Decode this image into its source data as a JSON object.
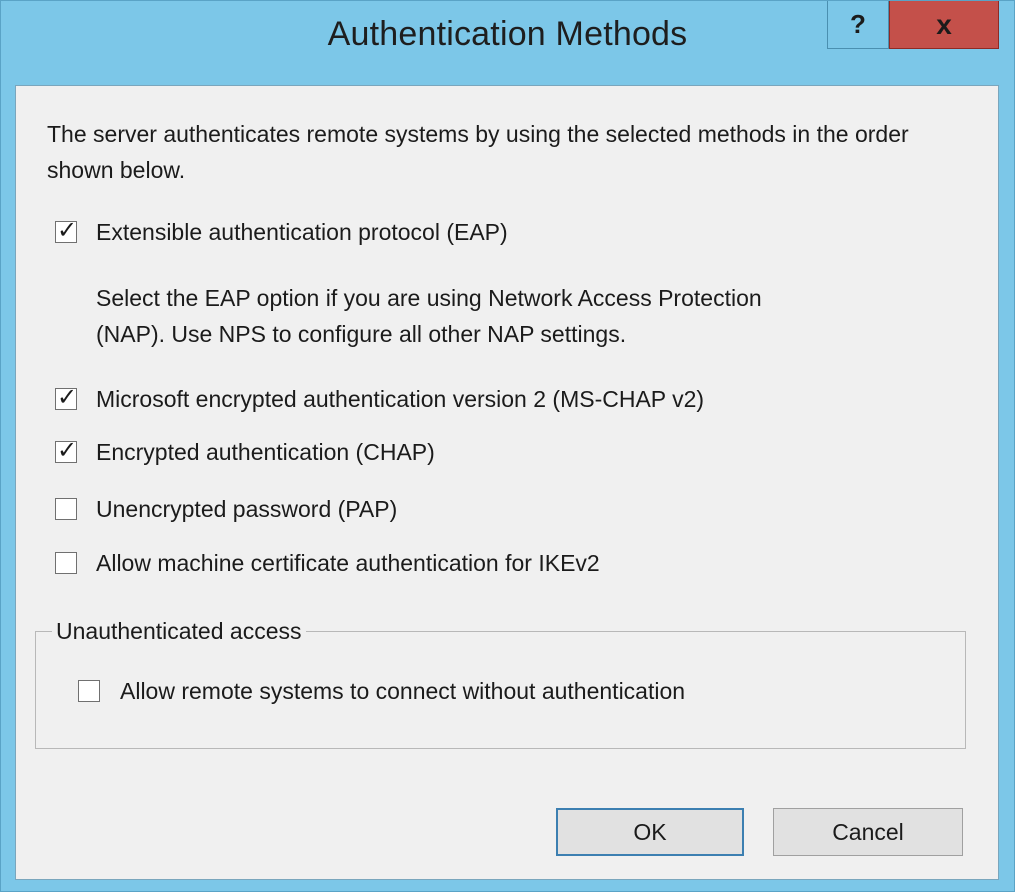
{
  "window": {
    "title": "Authentication Methods",
    "help_glyph": "?",
    "close_glyph": "x"
  },
  "description": "The server authenticates remote systems by using the selected methods in the order shown below.",
  "methods": [
    {
      "label": "Extensible authentication protocol (EAP)",
      "checked": true,
      "check_glyph": "✓"
    },
    {
      "label": "Microsoft encrypted authentication version 2 (MS-CHAP v2)",
      "checked": true,
      "check_glyph": "✓"
    },
    {
      "label": "Encrypted authentication (CHAP)",
      "checked": true,
      "check_glyph": "✓"
    },
    {
      "label": "Unencrypted password (PAP)",
      "checked": false,
      "check_glyph": ""
    },
    {
      "label": "Allow machine certificate authentication for IKEv2",
      "checked": false,
      "check_glyph": ""
    }
  ],
  "eap_note": {
    "line1": "Select the EAP option if you are using Network Access Protection",
    "line2": "(NAP). Use NPS to configure all other NAP settings."
  },
  "unauthenticated": {
    "group_label": "Unauthenticated access",
    "option": {
      "label": "Allow remote systems to connect without authentication",
      "checked": false,
      "check_glyph": ""
    }
  },
  "buttons": {
    "ok_label": "OK",
    "cancel_label": "Cancel"
  },
  "colors": {
    "titlebar": "#7cc7e8",
    "close_button": "#c4504a",
    "dialog_body": "#f0f0f0"
  }
}
